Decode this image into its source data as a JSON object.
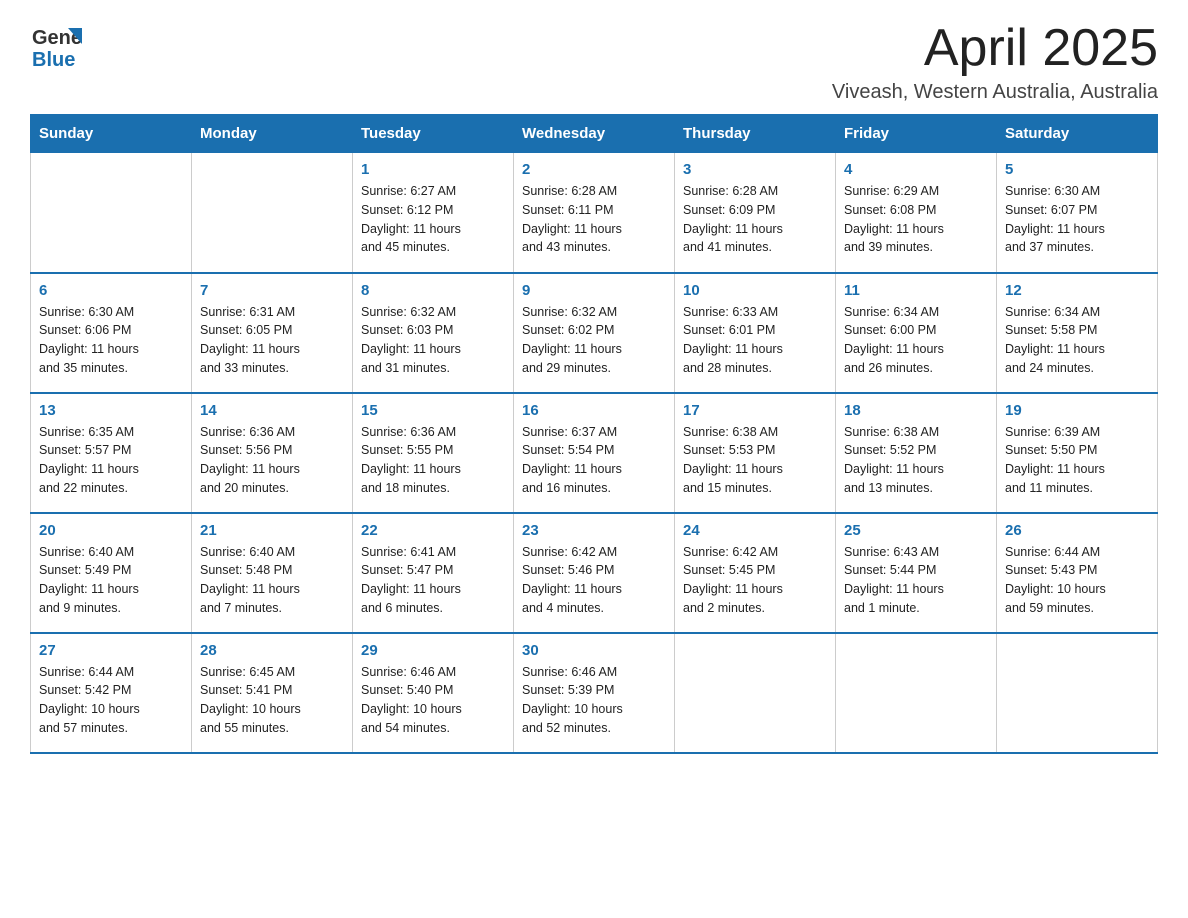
{
  "header": {
    "logo_general": "General",
    "logo_blue": "Blue",
    "month_title": "April 2025",
    "location": "Viveash, Western Australia, Australia"
  },
  "days_of_week": [
    "Sunday",
    "Monday",
    "Tuesday",
    "Wednesday",
    "Thursday",
    "Friday",
    "Saturday"
  ],
  "weeks": [
    [
      {
        "day": "",
        "info": ""
      },
      {
        "day": "",
        "info": ""
      },
      {
        "day": "1",
        "info": "Sunrise: 6:27 AM\nSunset: 6:12 PM\nDaylight: 11 hours\nand 45 minutes."
      },
      {
        "day": "2",
        "info": "Sunrise: 6:28 AM\nSunset: 6:11 PM\nDaylight: 11 hours\nand 43 minutes."
      },
      {
        "day": "3",
        "info": "Sunrise: 6:28 AM\nSunset: 6:09 PM\nDaylight: 11 hours\nand 41 minutes."
      },
      {
        "day": "4",
        "info": "Sunrise: 6:29 AM\nSunset: 6:08 PM\nDaylight: 11 hours\nand 39 minutes."
      },
      {
        "day": "5",
        "info": "Sunrise: 6:30 AM\nSunset: 6:07 PM\nDaylight: 11 hours\nand 37 minutes."
      }
    ],
    [
      {
        "day": "6",
        "info": "Sunrise: 6:30 AM\nSunset: 6:06 PM\nDaylight: 11 hours\nand 35 minutes."
      },
      {
        "day": "7",
        "info": "Sunrise: 6:31 AM\nSunset: 6:05 PM\nDaylight: 11 hours\nand 33 minutes."
      },
      {
        "day": "8",
        "info": "Sunrise: 6:32 AM\nSunset: 6:03 PM\nDaylight: 11 hours\nand 31 minutes."
      },
      {
        "day": "9",
        "info": "Sunrise: 6:32 AM\nSunset: 6:02 PM\nDaylight: 11 hours\nand 29 minutes."
      },
      {
        "day": "10",
        "info": "Sunrise: 6:33 AM\nSunset: 6:01 PM\nDaylight: 11 hours\nand 28 minutes."
      },
      {
        "day": "11",
        "info": "Sunrise: 6:34 AM\nSunset: 6:00 PM\nDaylight: 11 hours\nand 26 minutes."
      },
      {
        "day": "12",
        "info": "Sunrise: 6:34 AM\nSunset: 5:58 PM\nDaylight: 11 hours\nand 24 minutes."
      }
    ],
    [
      {
        "day": "13",
        "info": "Sunrise: 6:35 AM\nSunset: 5:57 PM\nDaylight: 11 hours\nand 22 minutes."
      },
      {
        "day": "14",
        "info": "Sunrise: 6:36 AM\nSunset: 5:56 PM\nDaylight: 11 hours\nand 20 minutes."
      },
      {
        "day": "15",
        "info": "Sunrise: 6:36 AM\nSunset: 5:55 PM\nDaylight: 11 hours\nand 18 minutes."
      },
      {
        "day": "16",
        "info": "Sunrise: 6:37 AM\nSunset: 5:54 PM\nDaylight: 11 hours\nand 16 minutes."
      },
      {
        "day": "17",
        "info": "Sunrise: 6:38 AM\nSunset: 5:53 PM\nDaylight: 11 hours\nand 15 minutes."
      },
      {
        "day": "18",
        "info": "Sunrise: 6:38 AM\nSunset: 5:52 PM\nDaylight: 11 hours\nand 13 minutes."
      },
      {
        "day": "19",
        "info": "Sunrise: 6:39 AM\nSunset: 5:50 PM\nDaylight: 11 hours\nand 11 minutes."
      }
    ],
    [
      {
        "day": "20",
        "info": "Sunrise: 6:40 AM\nSunset: 5:49 PM\nDaylight: 11 hours\nand 9 minutes."
      },
      {
        "day": "21",
        "info": "Sunrise: 6:40 AM\nSunset: 5:48 PM\nDaylight: 11 hours\nand 7 minutes."
      },
      {
        "day": "22",
        "info": "Sunrise: 6:41 AM\nSunset: 5:47 PM\nDaylight: 11 hours\nand 6 minutes."
      },
      {
        "day": "23",
        "info": "Sunrise: 6:42 AM\nSunset: 5:46 PM\nDaylight: 11 hours\nand 4 minutes."
      },
      {
        "day": "24",
        "info": "Sunrise: 6:42 AM\nSunset: 5:45 PM\nDaylight: 11 hours\nand 2 minutes."
      },
      {
        "day": "25",
        "info": "Sunrise: 6:43 AM\nSunset: 5:44 PM\nDaylight: 11 hours\nand 1 minute."
      },
      {
        "day": "26",
        "info": "Sunrise: 6:44 AM\nSunset: 5:43 PM\nDaylight: 10 hours\nand 59 minutes."
      }
    ],
    [
      {
        "day": "27",
        "info": "Sunrise: 6:44 AM\nSunset: 5:42 PM\nDaylight: 10 hours\nand 57 minutes."
      },
      {
        "day": "28",
        "info": "Sunrise: 6:45 AM\nSunset: 5:41 PM\nDaylight: 10 hours\nand 55 minutes."
      },
      {
        "day": "29",
        "info": "Sunrise: 6:46 AM\nSunset: 5:40 PM\nDaylight: 10 hours\nand 54 minutes."
      },
      {
        "day": "30",
        "info": "Sunrise: 6:46 AM\nSunset: 5:39 PM\nDaylight: 10 hours\nand 52 minutes."
      },
      {
        "day": "",
        "info": ""
      },
      {
        "day": "",
        "info": ""
      },
      {
        "day": "",
        "info": ""
      }
    ]
  ]
}
